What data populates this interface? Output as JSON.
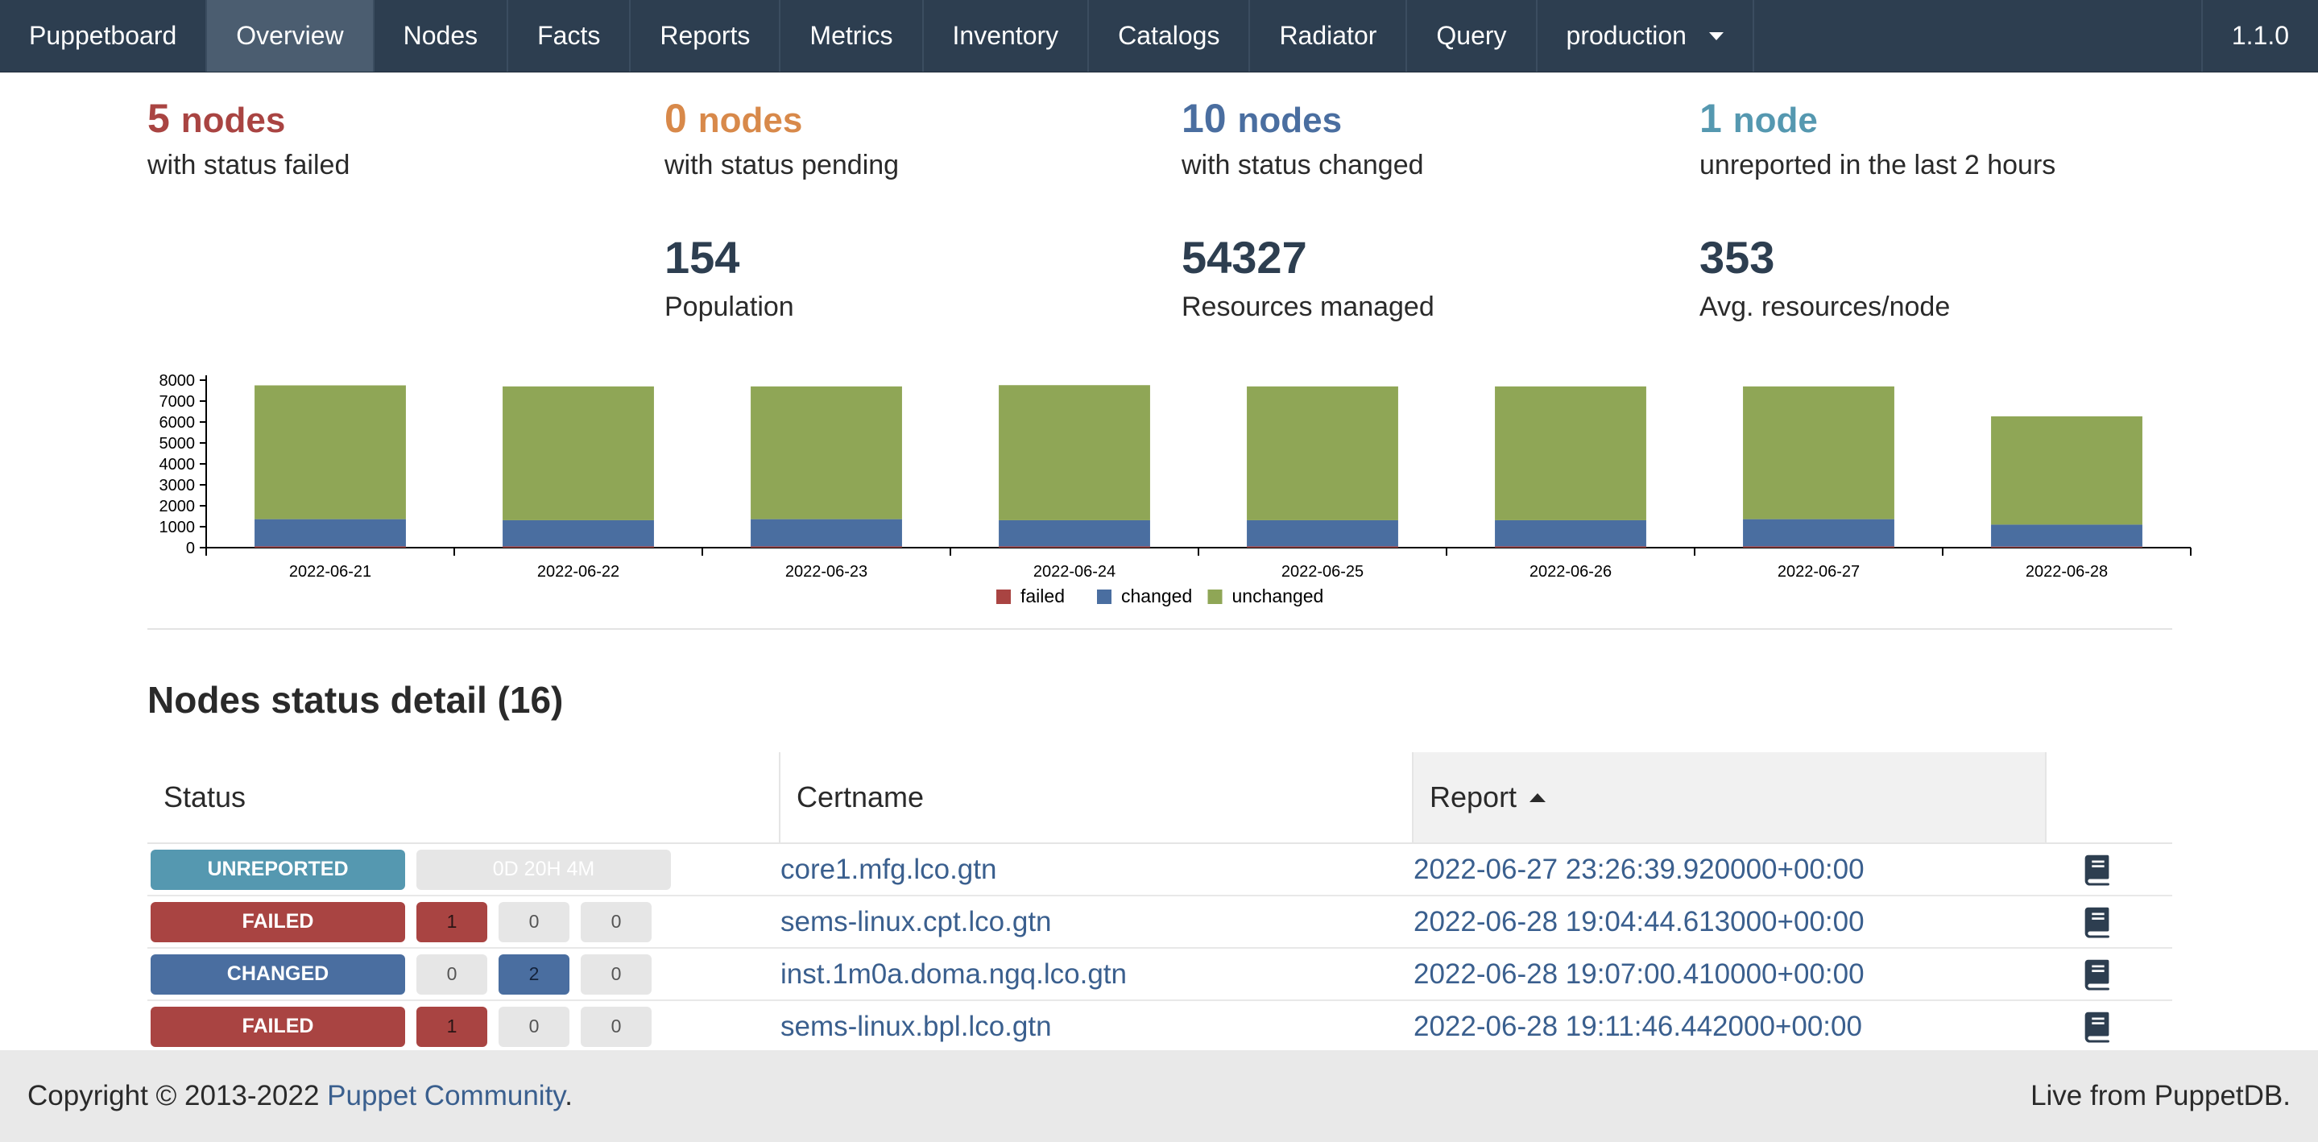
{
  "navbar": {
    "brand": "Puppetboard",
    "items": [
      "Overview",
      "Nodes",
      "Facts",
      "Reports",
      "Metrics",
      "Inventory",
      "Catalogs",
      "Radiator",
      "Query"
    ],
    "active": "Overview",
    "environment": "production",
    "version": "1.1.0"
  },
  "stats": {
    "failed": {
      "count": "5",
      "unit": "nodes",
      "label": "with status failed"
    },
    "pending": {
      "count": "0",
      "unit": "nodes",
      "label": "with status pending"
    },
    "changed": {
      "count": "10",
      "unit": "nodes",
      "label": "with status changed"
    },
    "unreported": {
      "count": "1",
      "unit": "node",
      "label": "unreported in the last 2 hours"
    },
    "population": {
      "value": "154",
      "label": "Population"
    },
    "resources": {
      "value": "54327",
      "label": "Resources managed"
    },
    "avg": {
      "value": "353",
      "label": "Avg. resources/node"
    }
  },
  "chart_data": {
    "type": "bar",
    "stacked": true,
    "categories": [
      "2022-06-21",
      "2022-06-22",
      "2022-06-23",
      "2022-06-24",
      "2022-06-25",
      "2022-06-26",
      "2022-06-27",
      "2022-06-28"
    ],
    "series": [
      {
        "name": "failed",
        "color": "#a94442",
        "values": [
          60,
          60,
          60,
          60,
          60,
          60,
          60,
          50
        ]
      },
      {
        "name": "changed",
        "color": "#4a6ea0",
        "values": [
          1300,
          1250,
          1300,
          1250,
          1250,
          1250,
          1300,
          1050
        ]
      },
      {
        "name": "unchanged",
        "color": "#8fa656",
        "values": [
          6390,
          6390,
          6340,
          6450,
          6390,
          6390,
          6340,
          5170
        ]
      }
    ],
    "yticks": [
      0,
      1000,
      2000,
      3000,
      4000,
      5000,
      6000,
      7000,
      8000
    ],
    "ylim": [
      0,
      8000
    ],
    "legend": "bottom-center"
  },
  "section": {
    "title": "Nodes status detail (16)"
  },
  "table": {
    "headers": {
      "status": "Status",
      "certname": "Certname",
      "report": "Report"
    },
    "rows": [
      {
        "status": "UNREPORTED",
        "kind": "unreported",
        "delta": "0D 20H 4M",
        "certname": "core1.mfg.lco.gtn",
        "report": "2022-06-27 23:26:39.920000+00:00"
      },
      {
        "status": "FAILED",
        "kind": "failed",
        "counts": [
          "1",
          "0",
          "0"
        ],
        "certname": "sems-linux.cpt.lco.gtn",
        "report": "2022-06-28 19:04:44.613000+00:00"
      },
      {
        "status": "CHANGED",
        "kind": "changed",
        "counts": [
          "0",
          "2",
          "0"
        ],
        "certname": "inst.1m0a.doma.ngq.lco.gtn",
        "report": "2022-06-28 19:07:00.410000+00:00"
      },
      {
        "status": "FAILED",
        "kind": "failed",
        "counts": [
          "1",
          "0",
          "0"
        ],
        "certname": "sems-linux.bpl.lco.gtn",
        "report": "2022-06-28 19:11:46.442000+00:00"
      }
    ]
  },
  "footer": {
    "copyright": "Copyright © 2013-2022",
    "link": "Puppet Community",
    "period": ".",
    "right": "Live from PuppetDB."
  }
}
